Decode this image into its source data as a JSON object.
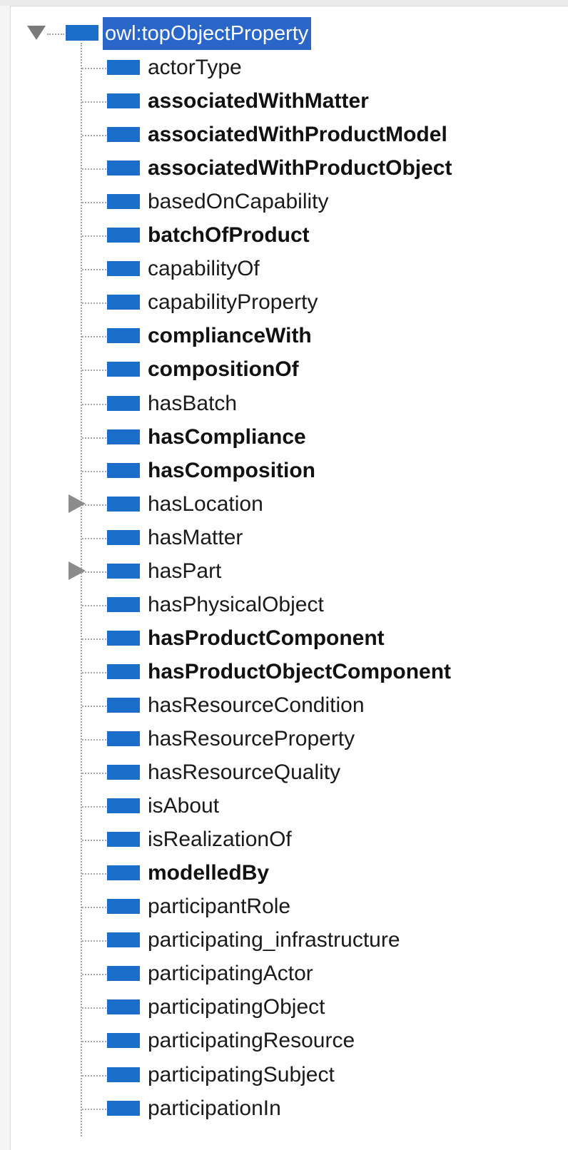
{
  "tree": {
    "root": {
      "label": "owl:topObjectProperty",
      "expanded": true,
      "selected": true
    },
    "icon_color": "#1a6ec9",
    "selection_color": "#2a66c8",
    "children": [
      {
        "label": "actorType",
        "bold": false,
        "expandable": false
      },
      {
        "label": "associatedWithMatter",
        "bold": true,
        "expandable": false
      },
      {
        "label": "associatedWithProductModel",
        "bold": true,
        "expandable": false
      },
      {
        "label": "associatedWithProductObject",
        "bold": true,
        "expandable": false
      },
      {
        "label": "basedOnCapability",
        "bold": false,
        "expandable": false
      },
      {
        "label": "batchOfProduct",
        "bold": true,
        "expandable": false
      },
      {
        "label": "capabilityOf",
        "bold": false,
        "expandable": false
      },
      {
        "label": "capabilityProperty",
        "bold": false,
        "expandable": false
      },
      {
        "label": "complianceWith",
        "bold": true,
        "expandable": false
      },
      {
        "label": "compositionOf",
        "bold": true,
        "expandable": false
      },
      {
        "label": "hasBatch",
        "bold": false,
        "expandable": false
      },
      {
        "label": "hasCompliance",
        "bold": true,
        "expandable": false
      },
      {
        "label": "hasComposition",
        "bold": true,
        "expandable": false
      },
      {
        "label": "hasLocation",
        "bold": false,
        "expandable": true
      },
      {
        "label": "hasMatter",
        "bold": false,
        "expandable": false
      },
      {
        "label": "hasPart",
        "bold": false,
        "expandable": true
      },
      {
        "label": "hasPhysicalObject",
        "bold": false,
        "expandable": false
      },
      {
        "label": "hasProductComponent",
        "bold": true,
        "expandable": false
      },
      {
        "label": "hasProductObjectComponent",
        "bold": true,
        "expandable": false
      },
      {
        "label": "hasResourceCondition",
        "bold": false,
        "expandable": false
      },
      {
        "label": "hasResourceProperty",
        "bold": false,
        "expandable": false
      },
      {
        "label": "hasResourceQuality",
        "bold": false,
        "expandable": false
      },
      {
        "label": "isAbout",
        "bold": false,
        "expandable": false
      },
      {
        "label": "isRealizationOf",
        "bold": false,
        "expandable": false
      },
      {
        "label": "modelledBy",
        "bold": true,
        "expandable": false
      },
      {
        "label": "participantRole",
        "bold": false,
        "expandable": false
      },
      {
        "label": "participating_infrastructure",
        "bold": false,
        "expandable": false
      },
      {
        "label": "participatingActor",
        "bold": false,
        "expandable": false
      },
      {
        "label": "participatingObject",
        "bold": false,
        "expandable": false
      },
      {
        "label": "participatingResource",
        "bold": false,
        "expandable": false
      },
      {
        "label": "participatingSubject",
        "bold": false,
        "expandable": false
      },
      {
        "label": "participationIn",
        "bold": false,
        "expandable": false
      }
    ]
  }
}
